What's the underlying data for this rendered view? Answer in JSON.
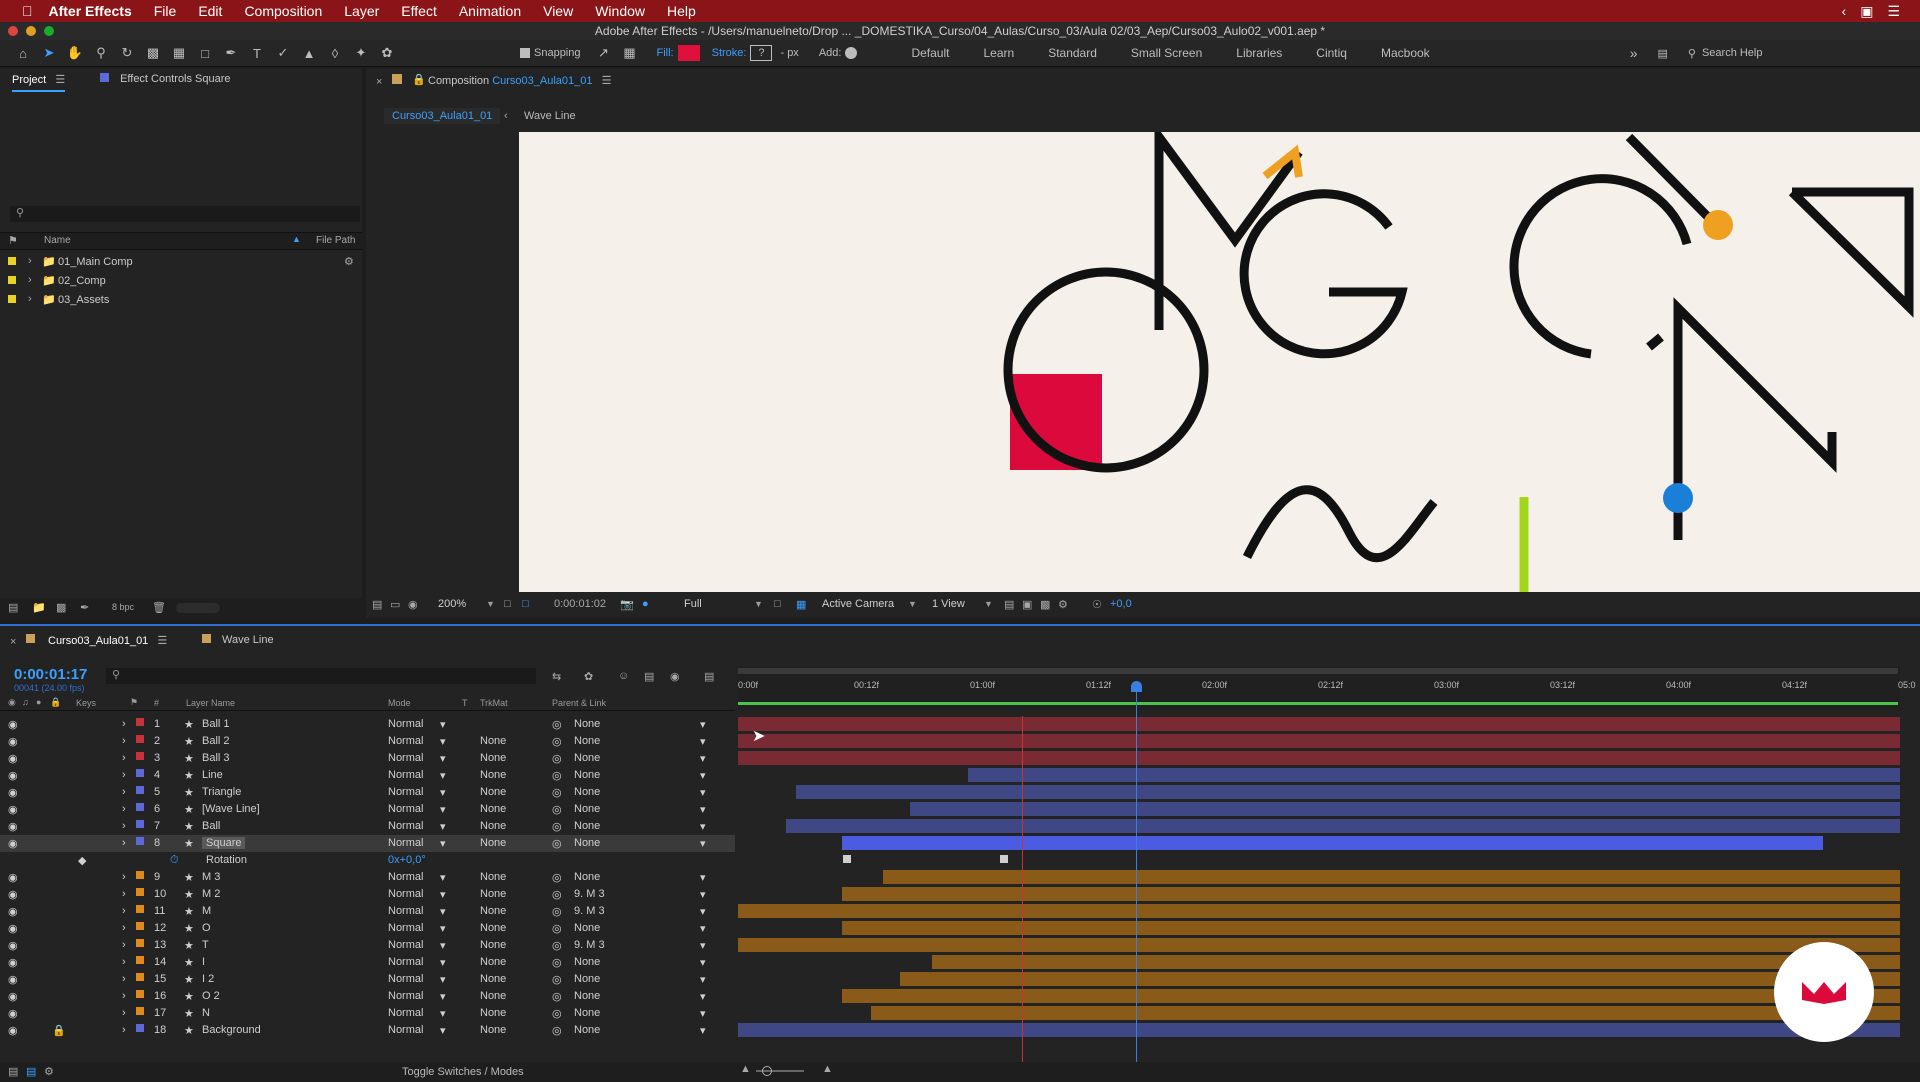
{
  "menubar": {
    "app": "After Effects",
    "items": [
      "File",
      "Edit",
      "Composition",
      "Layer",
      "Effect",
      "Animation",
      "View",
      "Window",
      "Help"
    ]
  },
  "titlebar": "Adobe After Effects - /Users/manuelneto/Drop ... _DOMESTIKA_Curso/04_Aulas/Curso_03/Aula 02/03_Aep/Curso03_Aulo02_v001.aep *",
  "toolbar": {
    "snapping": "Snapping",
    "fill": "Fill:",
    "stroke": "Stroke:",
    "stroke_value": "?",
    "px": "- px",
    "add": "Add:",
    "workspaces": [
      "Default",
      "Learn",
      "Standard",
      "Small Screen",
      "Libraries",
      "Cintiq",
      "Macbook"
    ],
    "search": "Search Help"
  },
  "project": {
    "tab": "Project",
    "tab2": "Effect Controls Square",
    "col_name": "Name",
    "col_path": "File Path",
    "items": [
      "01_Main Comp",
      "02_Comp",
      "03_Assets"
    ],
    "bpc": "8 bpc"
  },
  "viewer": {
    "tab_label": "Composition",
    "tab_comp": "Curso03_Aula01_01",
    "crumb1": "Curso03_Aula01_01",
    "crumb2": "Wave Line",
    "zoom": "200%",
    "timecode": "0:00:01:02",
    "quality": "Full",
    "camera": "Active Camera",
    "views": "1 View",
    "exposure": "+0,0"
  },
  "timeline": {
    "tab": "Curso03_Aula01_01",
    "tab2": "Wave Line",
    "time": "0:00:01:17",
    "frames": "00041 (24.00 fps)",
    "headers": {
      "keys": "Keys",
      "num": "#",
      "name": "Layer Name",
      "mode": "Mode",
      "t": "T",
      "trkmat": "TrkMat",
      "parent": "Parent & Link"
    },
    "ruler": [
      "0:00f",
      "00:12f",
      "01:00f",
      "01:12f",
      "02:00f",
      "02:12f",
      "03:00f",
      "03:12f",
      "04:00f",
      "04:12f",
      "05:0"
    ],
    "layers": [
      {
        "n": "1",
        "name": "Ball 1",
        "mode": "Normal",
        "trk": "",
        "parent": "None",
        "color": "#c8323a"
      },
      {
        "n": "2",
        "name": "Ball 2",
        "mode": "Normal",
        "trk": "None",
        "parent": "None",
        "color": "#c8323a"
      },
      {
        "n": "3",
        "name": "Ball 3",
        "mode": "Normal",
        "trk": "None",
        "parent": "None",
        "color": "#c8323a"
      },
      {
        "n": "4",
        "name": "Line",
        "mode": "Normal",
        "trk": "None",
        "parent": "None",
        "color": "#5b6ad6"
      },
      {
        "n": "5",
        "name": "Triangle",
        "mode": "Normal",
        "trk": "None",
        "parent": "None",
        "color": "#5b6ad6"
      },
      {
        "n": "6",
        "name": "[Wave Line]",
        "mode": "Normal",
        "trk": "None",
        "parent": "None",
        "color": "#5b6ad6"
      },
      {
        "n": "7",
        "name": "Ball",
        "mode": "Normal",
        "trk": "None",
        "parent": "None",
        "color": "#5b6ad6"
      },
      {
        "n": "8",
        "name": "Square",
        "mode": "Normal",
        "trk": "None",
        "parent": "None",
        "color": "#5b6ad6"
      },
      {
        "n": "9",
        "name": "M 3",
        "mode": "Normal",
        "trk": "None",
        "parent": "None",
        "color": "#e08a1c"
      },
      {
        "n": "10",
        "name": "M 2",
        "mode": "Normal",
        "trk": "None",
        "parent": "9. M 3",
        "color": "#e08a1c"
      },
      {
        "n": "11",
        "name": "M",
        "mode": "Normal",
        "trk": "None",
        "parent": "9. M 3",
        "color": "#e08a1c"
      },
      {
        "n": "12",
        "name": "O",
        "mode": "Normal",
        "trk": "None",
        "parent": "None",
        "color": "#e08a1c"
      },
      {
        "n": "13",
        "name": "T",
        "mode": "Normal",
        "trk": "None",
        "parent": "9. M 3",
        "color": "#e08a1c"
      },
      {
        "n": "14",
        "name": "I",
        "mode": "Normal",
        "trk": "None",
        "parent": "None",
        "color": "#e08a1c"
      },
      {
        "n": "15",
        "name": "I 2",
        "mode": "Normal",
        "trk": "None",
        "parent": "None",
        "color": "#e08a1c"
      },
      {
        "n": "16",
        "name": "O 2",
        "mode": "Normal",
        "trk": "None",
        "parent": "None",
        "color": "#e08a1c"
      },
      {
        "n": "17",
        "name": "N",
        "mode": "Normal",
        "trk": "None",
        "parent": "None",
        "color": "#e08a1c"
      },
      {
        "n": "18",
        "name": "Background",
        "mode": "Normal",
        "trk": "None",
        "parent": "None",
        "color": "#5b6ad6"
      }
    ],
    "rotation_label": "Rotation",
    "rotation_value": "0x+0,0°",
    "toggle": "Toggle Switches / Modes"
  }
}
